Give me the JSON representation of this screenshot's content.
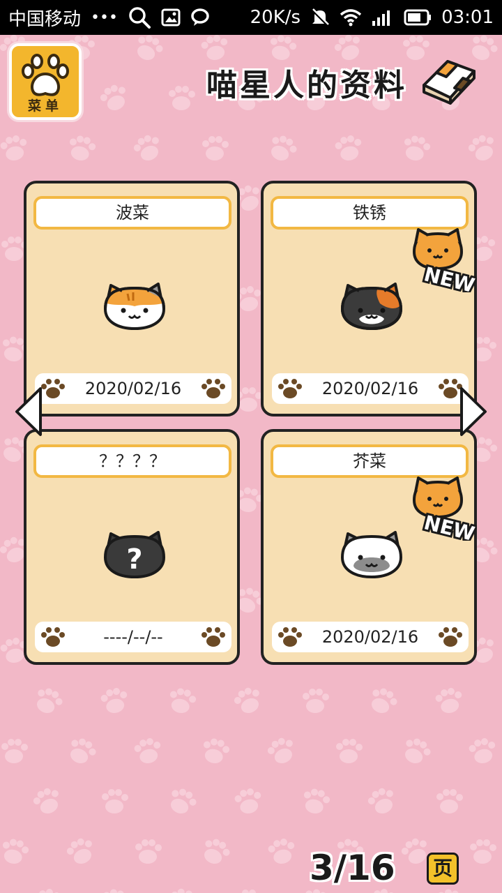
{
  "status_bar": {
    "carrier": "中国移动",
    "dots": "•••",
    "speed": "20K/s",
    "time": "03:01",
    "icons": [
      "search-icon",
      "image-icon",
      "chat-icon",
      "mute-icon",
      "wifi-icon",
      "signal-icon",
      "battery-icon"
    ]
  },
  "menu": {
    "label": "菜单",
    "icon": "paw-icon"
  },
  "header": {
    "title": "喵星人的资料",
    "icon": "book-icon"
  },
  "cards": [
    {
      "name": "波菜",
      "date": "2020/02/16",
      "is_new": false,
      "cat": "orange-white-cat"
    },
    {
      "name": "铁锈",
      "date": "2020/02/16",
      "is_new": true,
      "cat": "tortoiseshell-cat"
    },
    {
      "name": "？？？？",
      "date": "----/--/--",
      "is_new": false,
      "cat": "unknown-cat"
    },
    {
      "name": "芥菜",
      "date": "2020/02/16",
      "is_new": true,
      "cat": "gray-white-cat"
    }
  ],
  "badge": {
    "text": "NEW"
  },
  "pagination": {
    "current": "3",
    "total": "16",
    "display": "3/16",
    "suffix": "页"
  },
  "colors": {
    "background": "#f2b8c7",
    "card": "#f7dfb3",
    "accent": "#f2b843",
    "paw_brown": "#6b4a25"
  }
}
